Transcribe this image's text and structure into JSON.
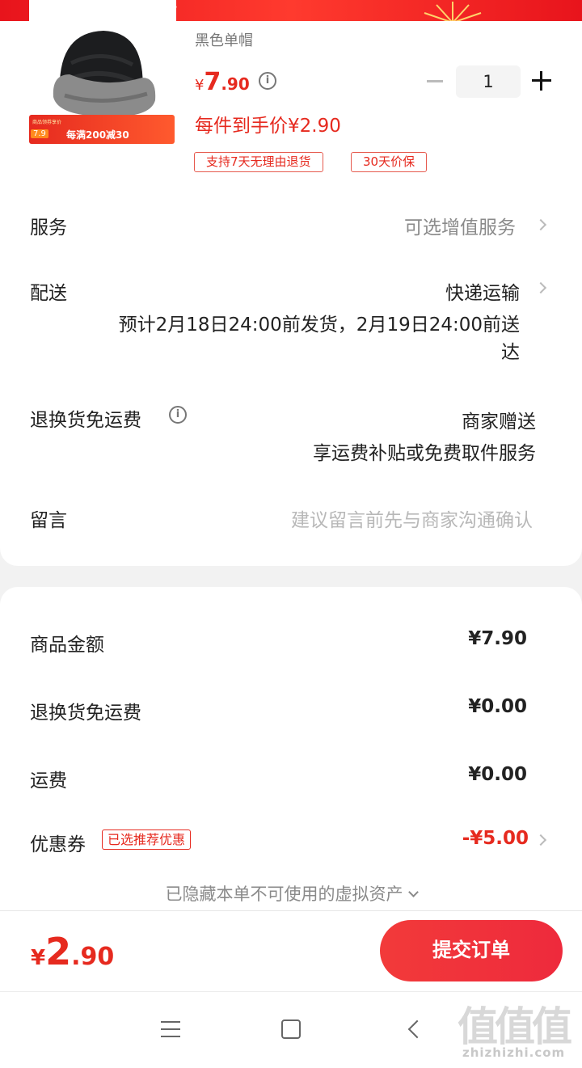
{
  "product": {
    "sku_name": "黑色单帽",
    "price_currency": "¥",
    "price_integer": "7",
    "price_decimal": ".90",
    "unit_price_text": "每件到手价¥2.90",
    "quantity": "1",
    "tags": [
      "支持7天无理由退货",
      "30天价保"
    ],
    "promo_badge": "7.9",
    "promo_text": "每满200减30",
    "promo_small": "商品领券享价"
  },
  "rows": {
    "service_label": "服务",
    "service_value": "可选增值服务",
    "delivery_label": "配送",
    "delivery_value": "快递运输",
    "delivery_estimate_line1": "预计2月18日24:00前发货，2月19日24:00前送",
    "delivery_estimate_line2": "达",
    "return_label": "退换货免运费",
    "return_value": "商家赠送",
    "return_desc": "享运费补贴或免费取件服务",
    "note_label": "留言",
    "note_placeholder": "建议留言前先与商家沟通确认"
  },
  "summary": {
    "goods_amount_label": "商品金额",
    "goods_amount_value": "¥7.90",
    "return_fee_label": "退换货免运费",
    "return_fee_value": "¥0.00",
    "shipping_label": "运费",
    "shipping_value": "¥0.00",
    "coupon_label": "优惠券",
    "coupon_badge": "已选推荐优惠",
    "coupon_value": "-¥5.00",
    "hidden_assets_text": "已隐藏本单不可使用的虚拟资产"
  },
  "footer": {
    "total_currency": "¥",
    "total_integer": "2",
    "total_decimal": ".90",
    "submit_label": "提交订单"
  },
  "watermark": {
    "mark": "值值值",
    "url": "zhizhizhi.com"
  },
  "colors": {
    "accent": "#e62a1f",
    "button": "#f23a3a"
  }
}
